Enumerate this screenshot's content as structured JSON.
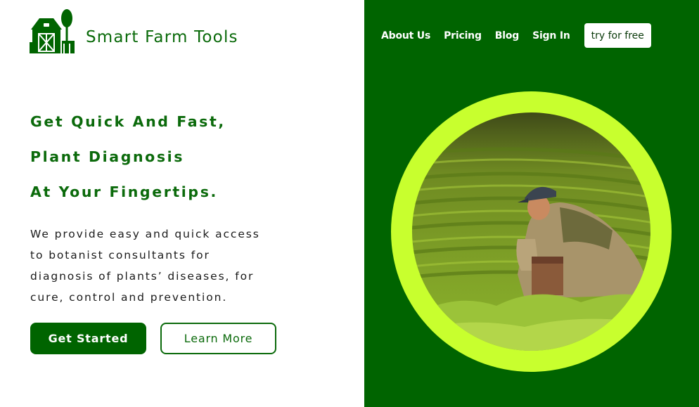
{
  "brand": {
    "name": "Smart Farm Tools",
    "logo_icon": "barn-with-tree-icon"
  },
  "nav": {
    "links": [
      "About Us",
      "Pricing",
      "Blog",
      "Sign In"
    ],
    "cta_label": "try for free"
  },
  "hero": {
    "headline": [
      "Get Quick And Fast,",
      "Plant Diagnosis",
      "At Your Fingertips."
    ],
    "description": [
      "We provide easy and quick access",
      "to botanist consultants for",
      "diagnosis of plants’ diseases, for",
      "cure, control and prevention."
    ],
    "primary_button": "Get Started",
    "secondary_button": "Learn More",
    "image": "farmer in a tea plantation"
  },
  "colors": {
    "brand_green": "#006400",
    "accent_lime": "#c8ff2e",
    "white": "#ffffff"
  }
}
